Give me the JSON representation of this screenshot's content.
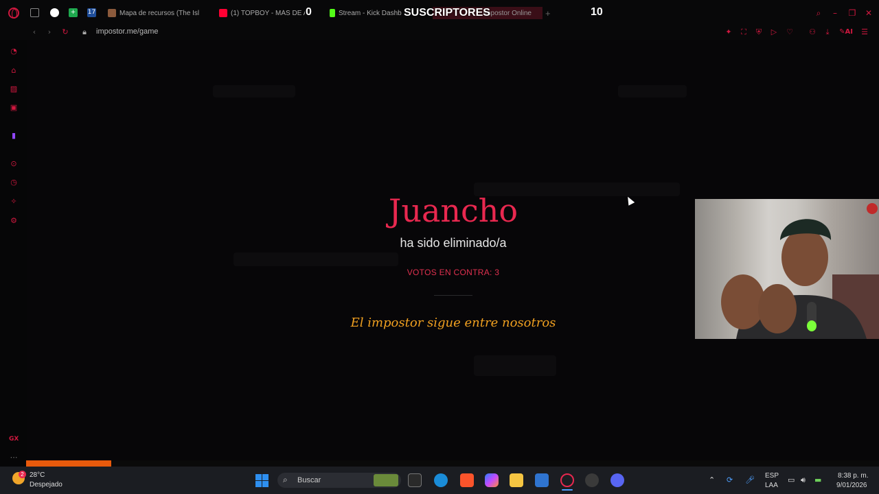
{
  "browser": {
    "tabs": [
      {
        "label": "Mapa de recursos (The Isl",
        "color": "#8b5a3c"
      },
      {
        "label": "(1) TOPBOY - MÁS DE A",
        "color": "#ff0033"
      },
      {
        "label": "Stream - Kick Dashb",
        "color": "#53fc18"
      },
      {
        "label": "Impostor Online",
        "color": "#e0304f"
      }
    ],
    "new_tab_label": "+",
    "url": "impostor.me/game"
  },
  "overlay": {
    "subscribers_label": "SUSCRIPTORES",
    "subscribers_current": "0",
    "subscribers_goal": "10"
  },
  "game": {
    "eliminated_name": "Juancho",
    "eliminated_text": "ha sido eliminado/a",
    "votes_label": "VOTOS EN CONTRA: 3",
    "verdict": "El impostor sigue entre nosotros"
  },
  "progress": {
    "value": 0.1
  },
  "taskbar": {
    "weather_temp": "28°C",
    "weather_desc": "Despejado",
    "weather_badge": "2",
    "search_placeholder": "Buscar",
    "lang_top": "ESP",
    "lang_bottom": "LAA",
    "time": "8:38 p. m.",
    "date": "9/01/2026"
  },
  "colors": {
    "accent": "#e8284f",
    "verdict": "#f0a020",
    "progress": "#e85a0c"
  }
}
